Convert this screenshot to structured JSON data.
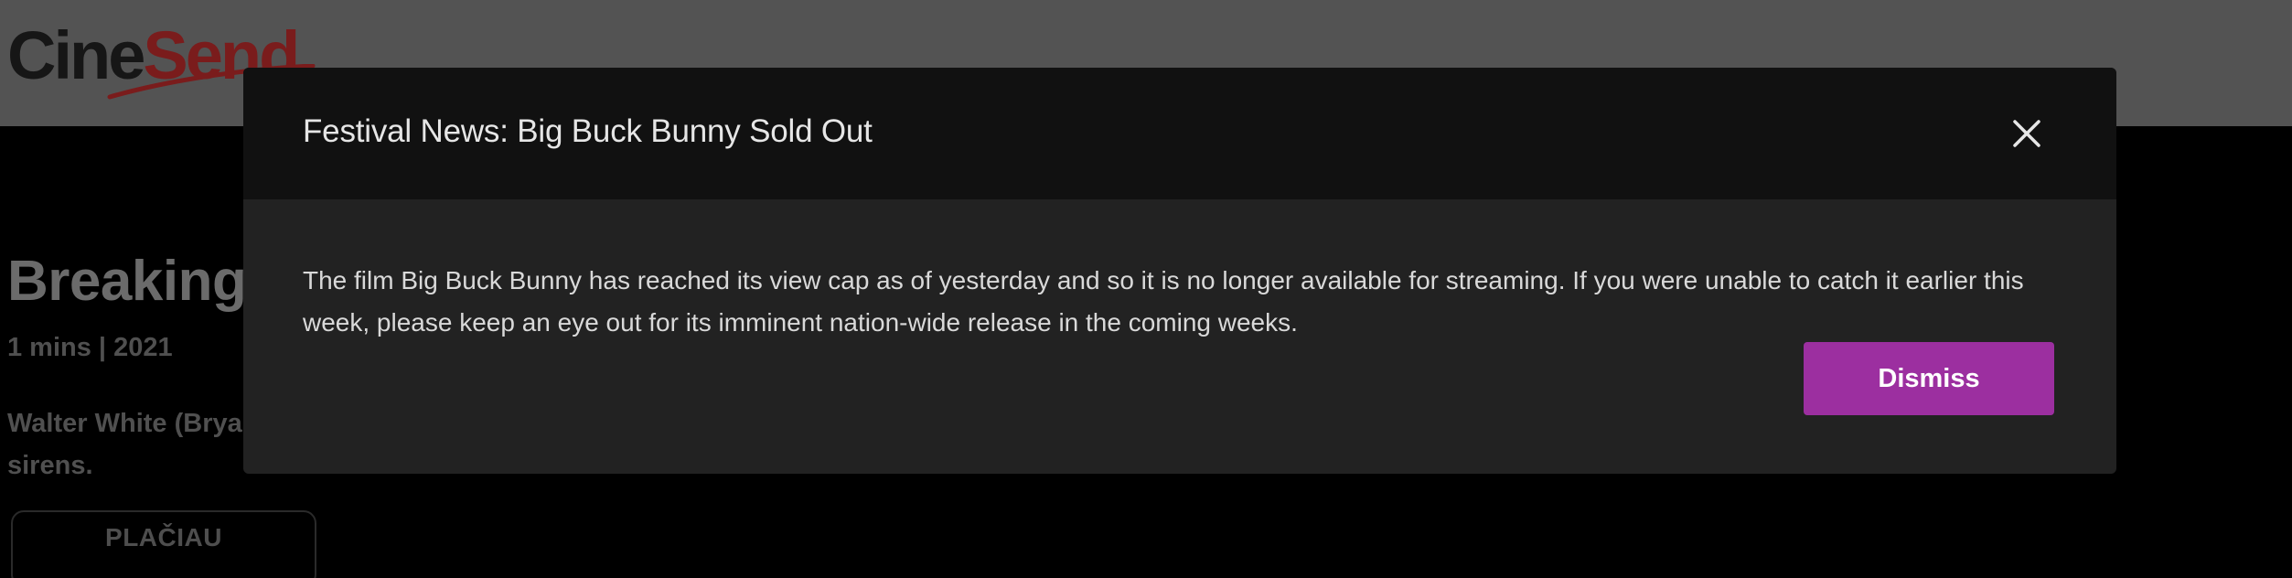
{
  "app": {
    "logo_part1": "Cine",
    "logo_part2": "Send"
  },
  "background": {
    "title": "Breaking",
    "meta": "1 mins | 2021",
    "description": "Walter White (Bryan sirens.",
    "play_label": "PLAČIAU"
  },
  "modal": {
    "title": "Festival News: Big Buck Bunny Sold Out",
    "body": "The film Big Buck Bunny has reached its view cap as of yesterday and so it is no longer available for streaming. If you were unable to catch it earlier this week, please keep an eye out for its imminent nation-wide release in the coming weeks.",
    "dismiss_label": "Dismiss"
  },
  "colors": {
    "accent": "#9c2fa0",
    "brand_red": "#7a1c1c",
    "overlay_header": "#111111",
    "overlay_body": "#222222"
  },
  "icons": {
    "close": "close-icon"
  }
}
